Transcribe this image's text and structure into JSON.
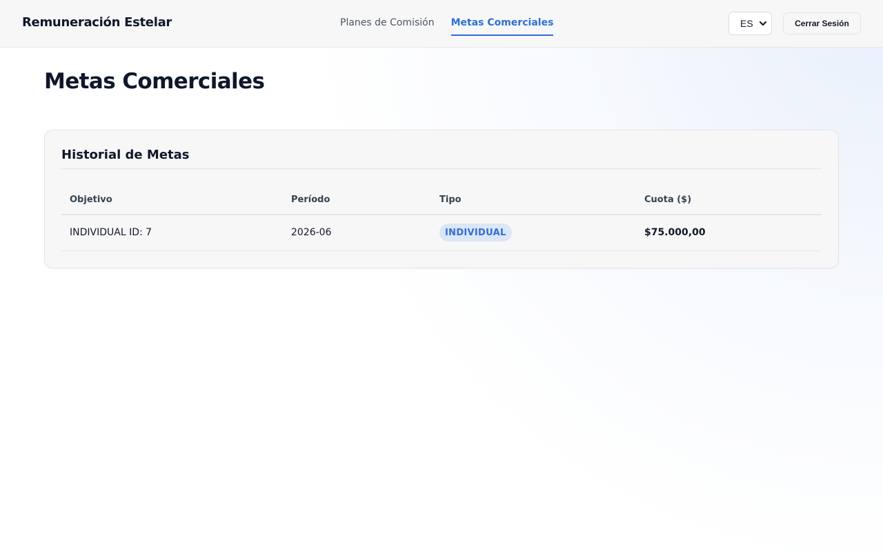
{
  "app": {
    "brand": "Remuneración Estelar"
  },
  "nav": {
    "items": [
      {
        "label": "Planes de Comisión",
        "active": false
      },
      {
        "label": "Metas Comerciales",
        "active": true
      }
    ]
  },
  "header": {
    "language": {
      "value": "ES"
    },
    "logout_label": "Cerrar Sesión"
  },
  "page": {
    "title": "Metas Comerciales"
  },
  "card": {
    "title": "Historial de Metas",
    "columns": [
      "Objetivo",
      "Período",
      "Tipo",
      "Cuota ($)"
    ],
    "rows": [
      {
        "objective": "INDIVIDUAL ID: 7",
        "period": "2026-06",
        "type": "INDIVIDUAL",
        "quota": "$75.000,00"
      }
    ]
  },
  "colors": {
    "accent": "#2f6fd6",
    "badge_bg": "#dbe6f7",
    "text": "#0f172a"
  }
}
